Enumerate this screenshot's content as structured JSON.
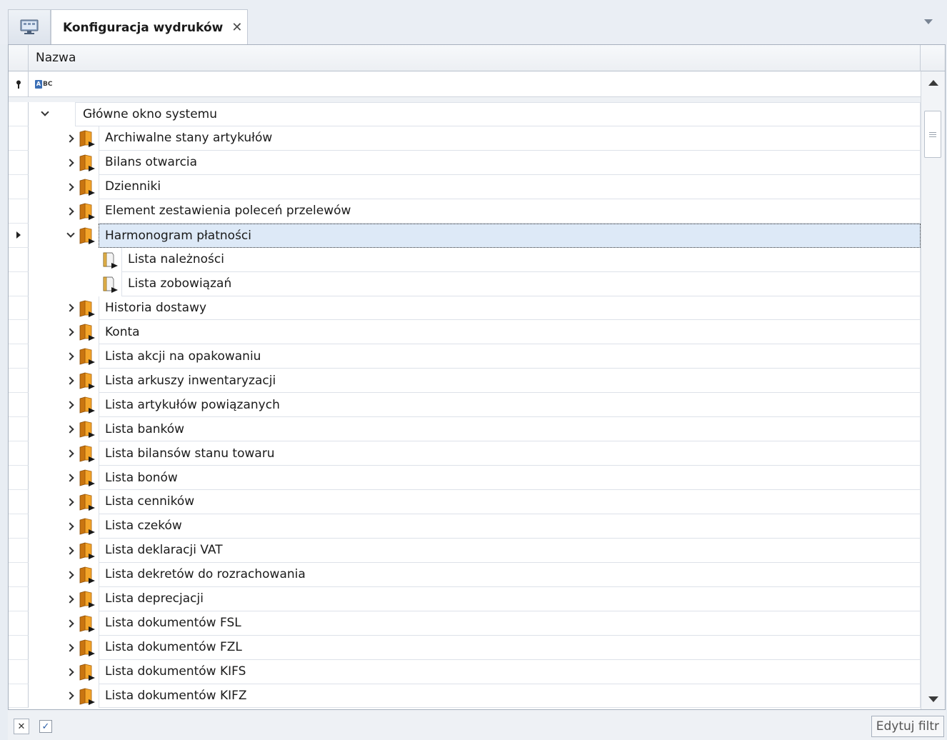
{
  "tab": {
    "title": "Konfiguracja wydruków",
    "close_glyph": "✕"
  },
  "grid": {
    "column_header": "Nazwa"
  },
  "colors": {
    "folder_orange": "#F29A1E",
    "selection_bg": "#DDE9F7",
    "accent_blue": "#3B6FB6"
  },
  "tree": {
    "root": {
      "label": "Główne okno systemu",
      "expanded": true
    },
    "rows": [
      {
        "label": "Archiwalne stany artykułów",
        "level": 1,
        "icon": "folder-icon",
        "expander": "collapsed"
      },
      {
        "label": "Bilans otwarcia",
        "level": 1,
        "icon": "folder-icon",
        "expander": "collapsed"
      },
      {
        "label": "Dzienniki",
        "level": 1,
        "icon": "folder-icon",
        "expander": "collapsed"
      },
      {
        "label": "Element zestawienia poleceń przelewów",
        "level": 1,
        "icon": "folder-icon",
        "expander": "collapsed"
      },
      {
        "label": "Harmonogram płatności",
        "level": 1,
        "icon": "folder-icon",
        "expander": "expanded",
        "selected": true
      },
      {
        "label": "Lista należności",
        "level": 2,
        "icon": "report-icon",
        "expander": "none"
      },
      {
        "label": "Lista zobowiązań",
        "level": 2,
        "icon": "report-icon",
        "expander": "none"
      },
      {
        "label": "Historia dostawy",
        "level": 1,
        "icon": "folder-icon",
        "expander": "collapsed"
      },
      {
        "label": "Konta",
        "level": 1,
        "icon": "folder-icon",
        "expander": "collapsed"
      },
      {
        "label": "Lista akcji na opakowaniu",
        "level": 1,
        "icon": "folder-icon",
        "expander": "collapsed"
      },
      {
        "label": "Lista arkuszy inwentaryzacji",
        "level": 1,
        "icon": "folder-icon",
        "expander": "collapsed"
      },
      {
        "label": "Lista artykułów powiązanych",
        "level": 1,
        "icon": "folder-icon",
        "expander": "collapsed"
      },
      {
        "label": "Lista banków",
        "level": 1,
        "icon": "folder-icon",
        "expander": "collapsed"
      },
      {
        "label": "Lista bilansów stanu towaru",
        "level": 1,
        "icon": "folder-icon",
        "expander": "collapsed"
      },
      {
        "label": "Lista bonów",
        "level": 1,
        "icon": "folder-icon",
        "expander": "collapsed"
      },
      {
        "label": "Lista cenników",
        "level": 1,
        "icon": "folder-icon",
        "expander": "collapsed"
      },
      {
        "label": "Lista czeków",
        "level": 1,
        "icon": "folder-icon",
        "expander": "collapsed"
      },
      {
        "label": "Lista deklaracji VAT",
        "level": 1,
        "icon": "folder-icon",
        "expander": "collapsed"
      },
      {
        "label": "Lista dekretów do rozrachowania",
        "level": 1,
        "icon": "folder-icon",
        "expander": "collapsed"
      },
      {
        "label": "Lista deprecjacji",
        "level": 1,
        "icon": "folder-icon",
        "expander": "collapsed"
      },
      {
        "label": "Lista dokumentów FSL",
        "level": 1,
        "icon": "folder-icon",
        "expander": "collapsed"
      },
      {
        "label": "Lista dokumentów FZL",
        "level": 1,
        "icon": "folder-icon",
        "expander": "collapsed"
      },
      {
        "label": "Lista dokumentów KIFS",
        "level": 1,
        "icon": "folder-icon",
        "expander": "collapsed"
      },
      {
        "label": "Lista dokumentów KIFZ",
        "level": 1,
        "icon": "folder-icon",
        "expander": "collapsed"
      }
    ]
  },
  "footer": {
    "edit_filter_label": "Edytuj filtr",
    "filter_enabled": true
  }
}
